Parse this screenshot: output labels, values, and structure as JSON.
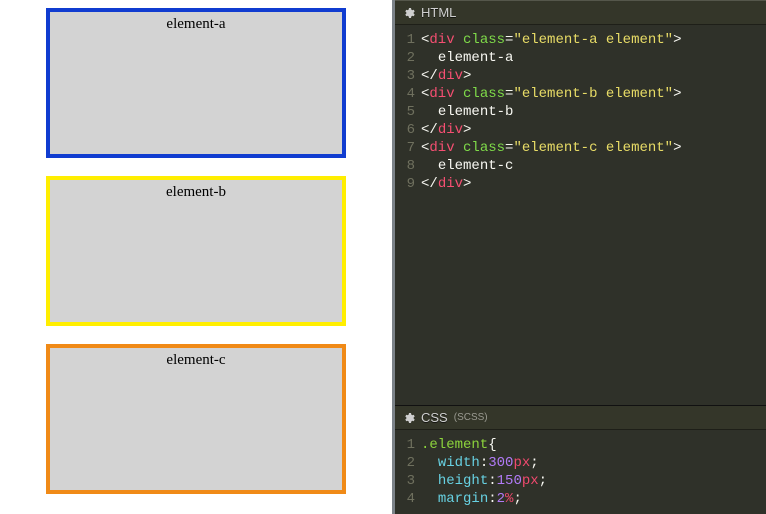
{
  "preview": {
    "elements": [
      {
        "label": "element-a"
      },
      {
        "label": "element-b"
      },
      {
        "label": "element-c"
      }
    ]
  },
  "editors": {
    "html": {
      "title": "HTML",
      "lines": [
        [
          {
            "c": "t-punct",
            "t": "<"
          },
          {
            "c": "t-tag",
            "t": "div"
          },
          {
            "c": "t-punct",
            "t": " "
          },
          {
            "c": "t-attr",
            "t": "class"
          },
          {
            "c": "t-punct",
            "t": "="
          },
          {
            "c": "t-string",
            "t": "\"element-a element\""
          },
          {
            "c": "t-punct",
            "t": ">"
          }
        ],
        [
          {
            "c": "t-indent",
            "t": "  "
          },
          {
            "c": "t-text",
            "t": "element-a"
          }
        ],
        [
          {
            "c": "t-punct",
            "t": "</"
          },
          {
            "c": "t-tag",
            "t": "div"
          },
          {
            "c": "t-punct",
            "t": ">"
          }
        ],
        [
          {
            "c": "t-punct",
            "t": "<"
          },
          {
            "c": "t-tag",
            "t": "div"
          },
          {
            "c": "t-punct",
            "t": " "
          },
          {
            "c": "t-attr",
            "t": "class"
          },
          {
            "c": "t-punct",
            "t": "="
          },
          {
            "c": "t-string",
            "t": "\"element-b element\""
          },
          {
            "c": "t-punct",
            "t": ">"
          }
        ],
        [
          {
            "c": "t-indent",
            "t": "  "
          },
          {
            "c": "t-text",
            "t": "element-b"
          }
        ],
        [
          {
            "c": "t-punct",
            "t": "</"
          },
          {
            "c": "t-tag",
            "t": "div"
          },
          {
            "c": "t-punct",
            "t": ">"
          }
        ],
        [
          {
            "c": "t-punct",
            "t": "<"
          },
          {
            "c": "t-tag",
            "t": "div"
          },
          {
            "c": "t-punct",
            "t": " "
          },
          {
            "c": "t-attr",
            "t": "class"
          },
          {
            "c": "t-punct",
            "t": "="
          },
          {
            "c": "t-string",
            "t": "\"element-c element\""
          },
          {
            "c": "t-punct",
            "t": ">"
          }
        ],
        [
          {
            "c": "t-indent",
            "t": "  "
          },
          {
            "c": "t-text",
            "t": "element-c"
          }
        ],
        [
          {
            "c": "t-punct",
            "t": "</"
          },
          {
            "c": "t-tag",
            "t": "div"
          },
          {
            "c": "t-punct",
            "t": ">"
          }
        ]
      ]
    },
    "css": {
      "title": "CSS",
      "sublabel": "(SCSS)",
      "lines": [
        [
          {
            "c": "t-sel",
            "t": ".element"
          },
          {
            "c": "t-punct",
            "t": "{"
          }
        ],
        [
          {
            "c": "t-indent",
            "t": "  "
          },
          {
            "c": "t-prop",
            "t": "width"
          },
          {
            "c": "t-punct",
            "t": ":"
          },
          {
            "c": "t-num",
            "t": "300"
          },
          {
            "c": "t-unit",
            "t": "px"
          },
          {
            "c": "t-punct",
            "t": ";"
          }
        ],
        [
          {
            "c": "t-indent",
            "t": "  "
          },
          {
            "c": "t-prop",
            "t": "height"
          },
          {
            "c": "t-punct",
            "t": ":"
          },
          {
            "c": "t-num",
            "t": "150"
          },
          {
            "c": "t-unit",
            "t": "px"
          },
          {
            "c": "t-punct",
            "t": ";"
          }
        ],
        [
          {
            "c": "t-indent",
            "t": "  "
          },
          {
            "c": "t-prop",
            "t": "margin"
          },
          {
            "c": "t-punct",
            "t": ":"
          },
          {
            "c": "t-num",
            "t": "2"
          },
          {
            "c": "t-unit",
            "t": "%"
          },
          {
            "c": "t-punct",
            "t": ";"
          }
        ]
      ]
    }
  }
}
